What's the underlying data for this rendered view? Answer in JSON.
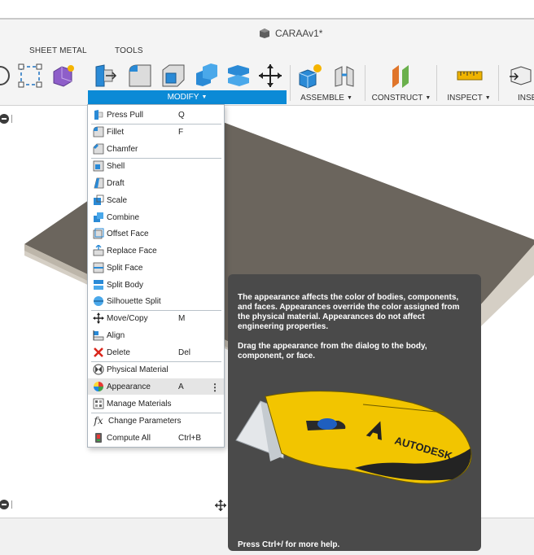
{
  "window": {
    "document_title": "CARAAv1*"
  },
  "toolbar": {
    "tabs": [
      {
        "label": "SHEET METAL"
      },
      {
        "label": "TOOLS"
      }
    ],
    "groups": {
      "modify": "MODIFY",
      "assemble": "ASSEMBLE",
      "construct": "CONSTRUCT",
      "inspect": "INSPECT",
      "insert": "INSE"
    },
    "accent_color": "#0b8ad6"
  },
  "modify_menu": {
    "items": [
      {
        "label": "Press Pull",
        "shortcut": "Q",
        "icon": "press-pull-icon"
      },
      {
        "label": "Fillet",
        "shortcut": "F",
        "icon": "fillet-icon"
      },
      {
        "label": "Chamfer",
        "shortcut": "",
        "icon": "chamfer-icon"
      },
      {
        "label": "Shell",
        "shortcut": "",
        "icon": "shell-icon"
      },
      {
        "label": "Draft",
        "shortcut": "",
        "icon": "draft-icon"
      },
      {
        "label": "Scale",
        "shortcut": "",
        "icon": "scale-icon"
      },
      {
        "label": "Combine",
        "shortcut": "",
        "icon": "combine-icon"
      },
      {
        "label": "Offset Face",
        "shortcut": "",
        "icon": "offset-face-icon"
      },
      {
        "label": "Replace Face",
        "shortcut": "",
        "icon": "replace-face-icon"
      },
      {
        "label": "Split Face",
        "shortcut": "",
        "icon": "split-face-icon"
      },
      {
        "label": "Split Body",
        "shortcut": "",
        "icon": "split-body-icon"
      },
      {
        "label": "Silhouette Split",
        "shortcut": "",
        "icon": "silhouette-split-icon"
      },
      {
        "label": "Move/Copy",
        "shortcut": "M",
        "icon": "move-copy-icon"
      },
      {
        "label": "Align",
        "shortcut": "",
        "icon": "align-icon"
      },
      {
        "label": "Delete",
        "shortcut": "Del",
        "icon": "delete-icon"
      },
      {
        "label": "Physical Material",
        "shortcut": "",
        "icon": "physical-material-icon"
      },
      {
        "label": "Appearance",
        "shortcut": "A",
        "icon": "appearance-icon",
        "highlighted": true
      },
      {
        "label": "Manage Materials",
        "shortcut": "",
        "icon": "manage-materials-icon"
      },
      {
        "label": "Change Parameters",
        "shortcut": "",
        "icon": "change-parameters-icon"
      },
      {
        "label": "Compute All",
        "shortcut": "Ctrl+B",
        "icon": "compute-all-icon"
      }
    ]
  },
  "tooltip": {
    "paragraph_1": "The appearance affects the color of bodies, components, and faces. Appearances override the color assigned from the physical material. Appearances do not affect engineering properties.",
    "paragraph_2": "Drag the appearance from the dialog to the body, component, or face.",
    "illustration_brand": "AUTODESK",
    "help": "Press Ctrl+/ for more help."
  }
}
